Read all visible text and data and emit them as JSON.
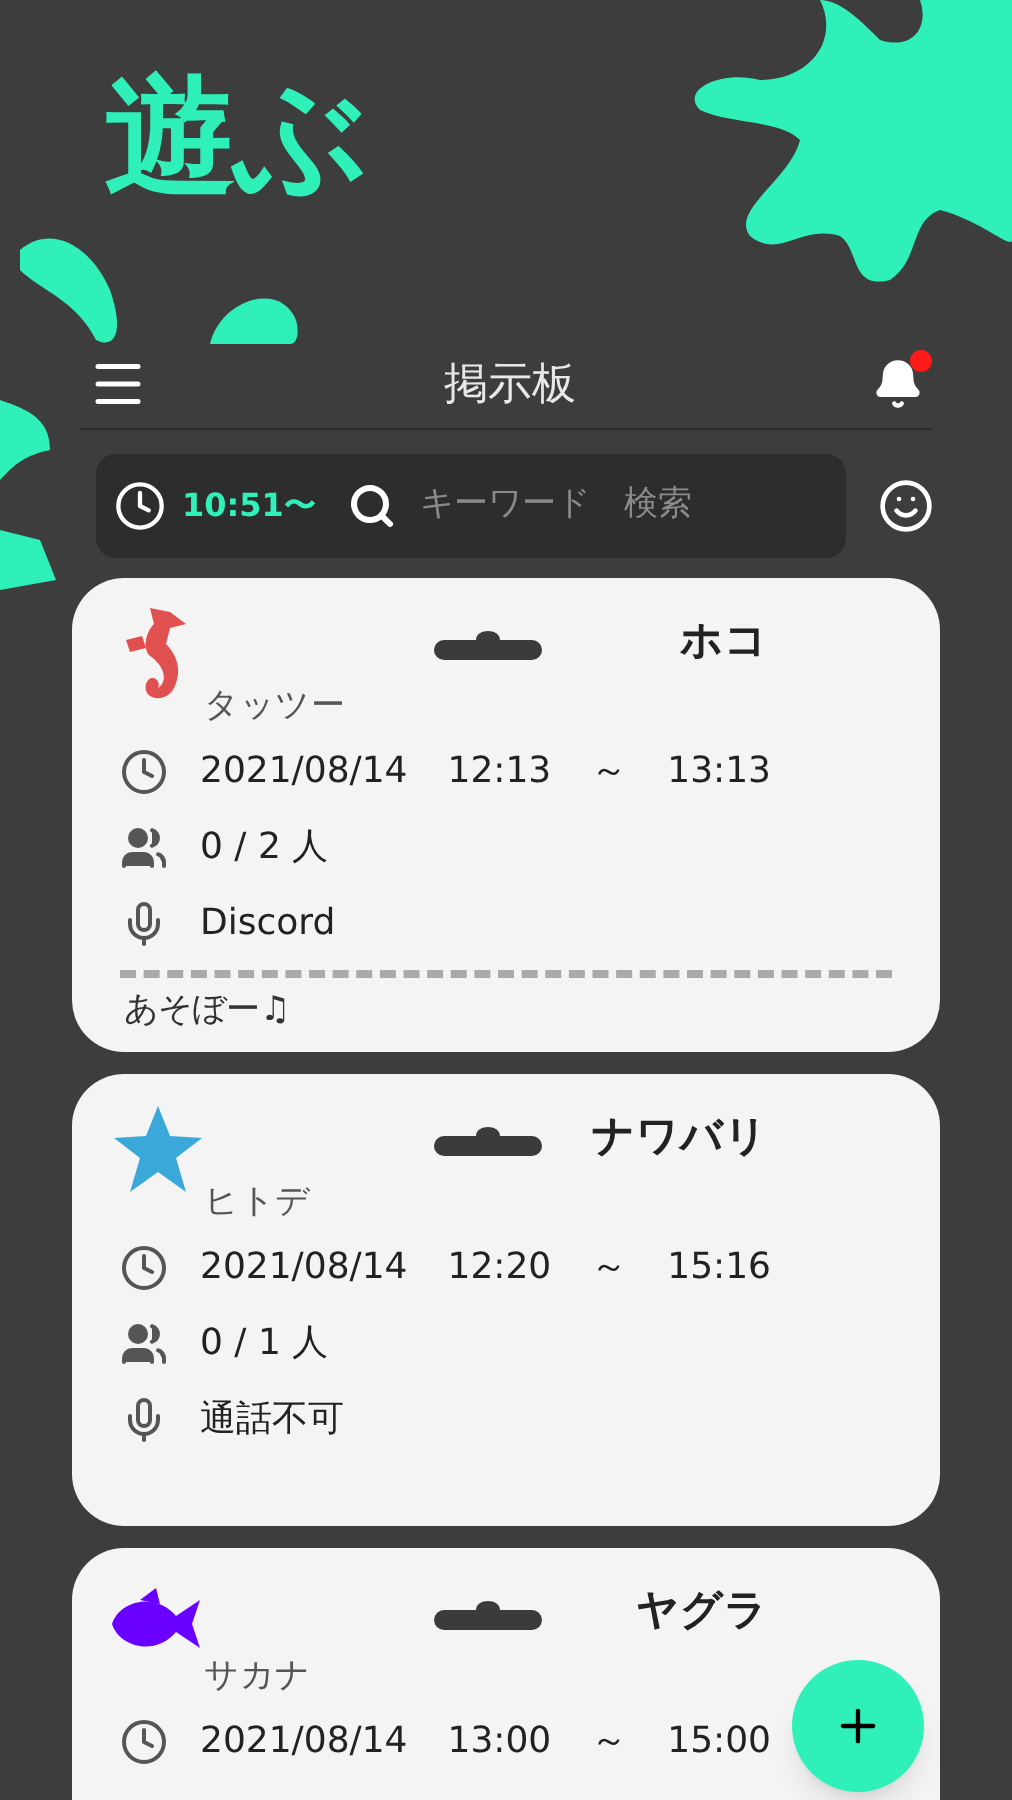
{
  "logo": "遊ぶ",
  "header": {
    "title": "掲示板",
    "notification": true
  },
  "search": {
    "time": "10:51〜",
    "placeholder": "キーワード　検索"
  },
  "posts": [
    {
      "avatar": {
        "kind": "seahorse",
        "color": "#e05050"
      },
      "mode": "ホコ",
      "user": "タッツー",
      "date": "2021/08/14",
      "start": "12:13",
      "range_mark": "～",
      "end": "13:13",
      "members": "0 / 2 人",
      "voice": "Discord",
      "comment": "あそぼー♫"
    },
    {
      "avatar": {
        "kind": "starfish",
        "color": "#3aa8d8"
      },
      "mode": "ナワバリ",
      "user": "ヒトデ",
      "date": "2021/08/14",
      "start": "12:20",
      "range_mark": "～",
      "end": "15:16",
      "members": "0 / 1 人",
      "voice": "通話不可"
    },
    {
      "avatar": {
        "kind": "fish",
        "color": "#6a00ff"
      },
      "mode": "ヤグラ",
      "user": "サカナ",
      "date": "2021/08/14",
      "start": "13:00",
      "range_mark": "～",
      "end": "15:00"
    }
  ]
}
